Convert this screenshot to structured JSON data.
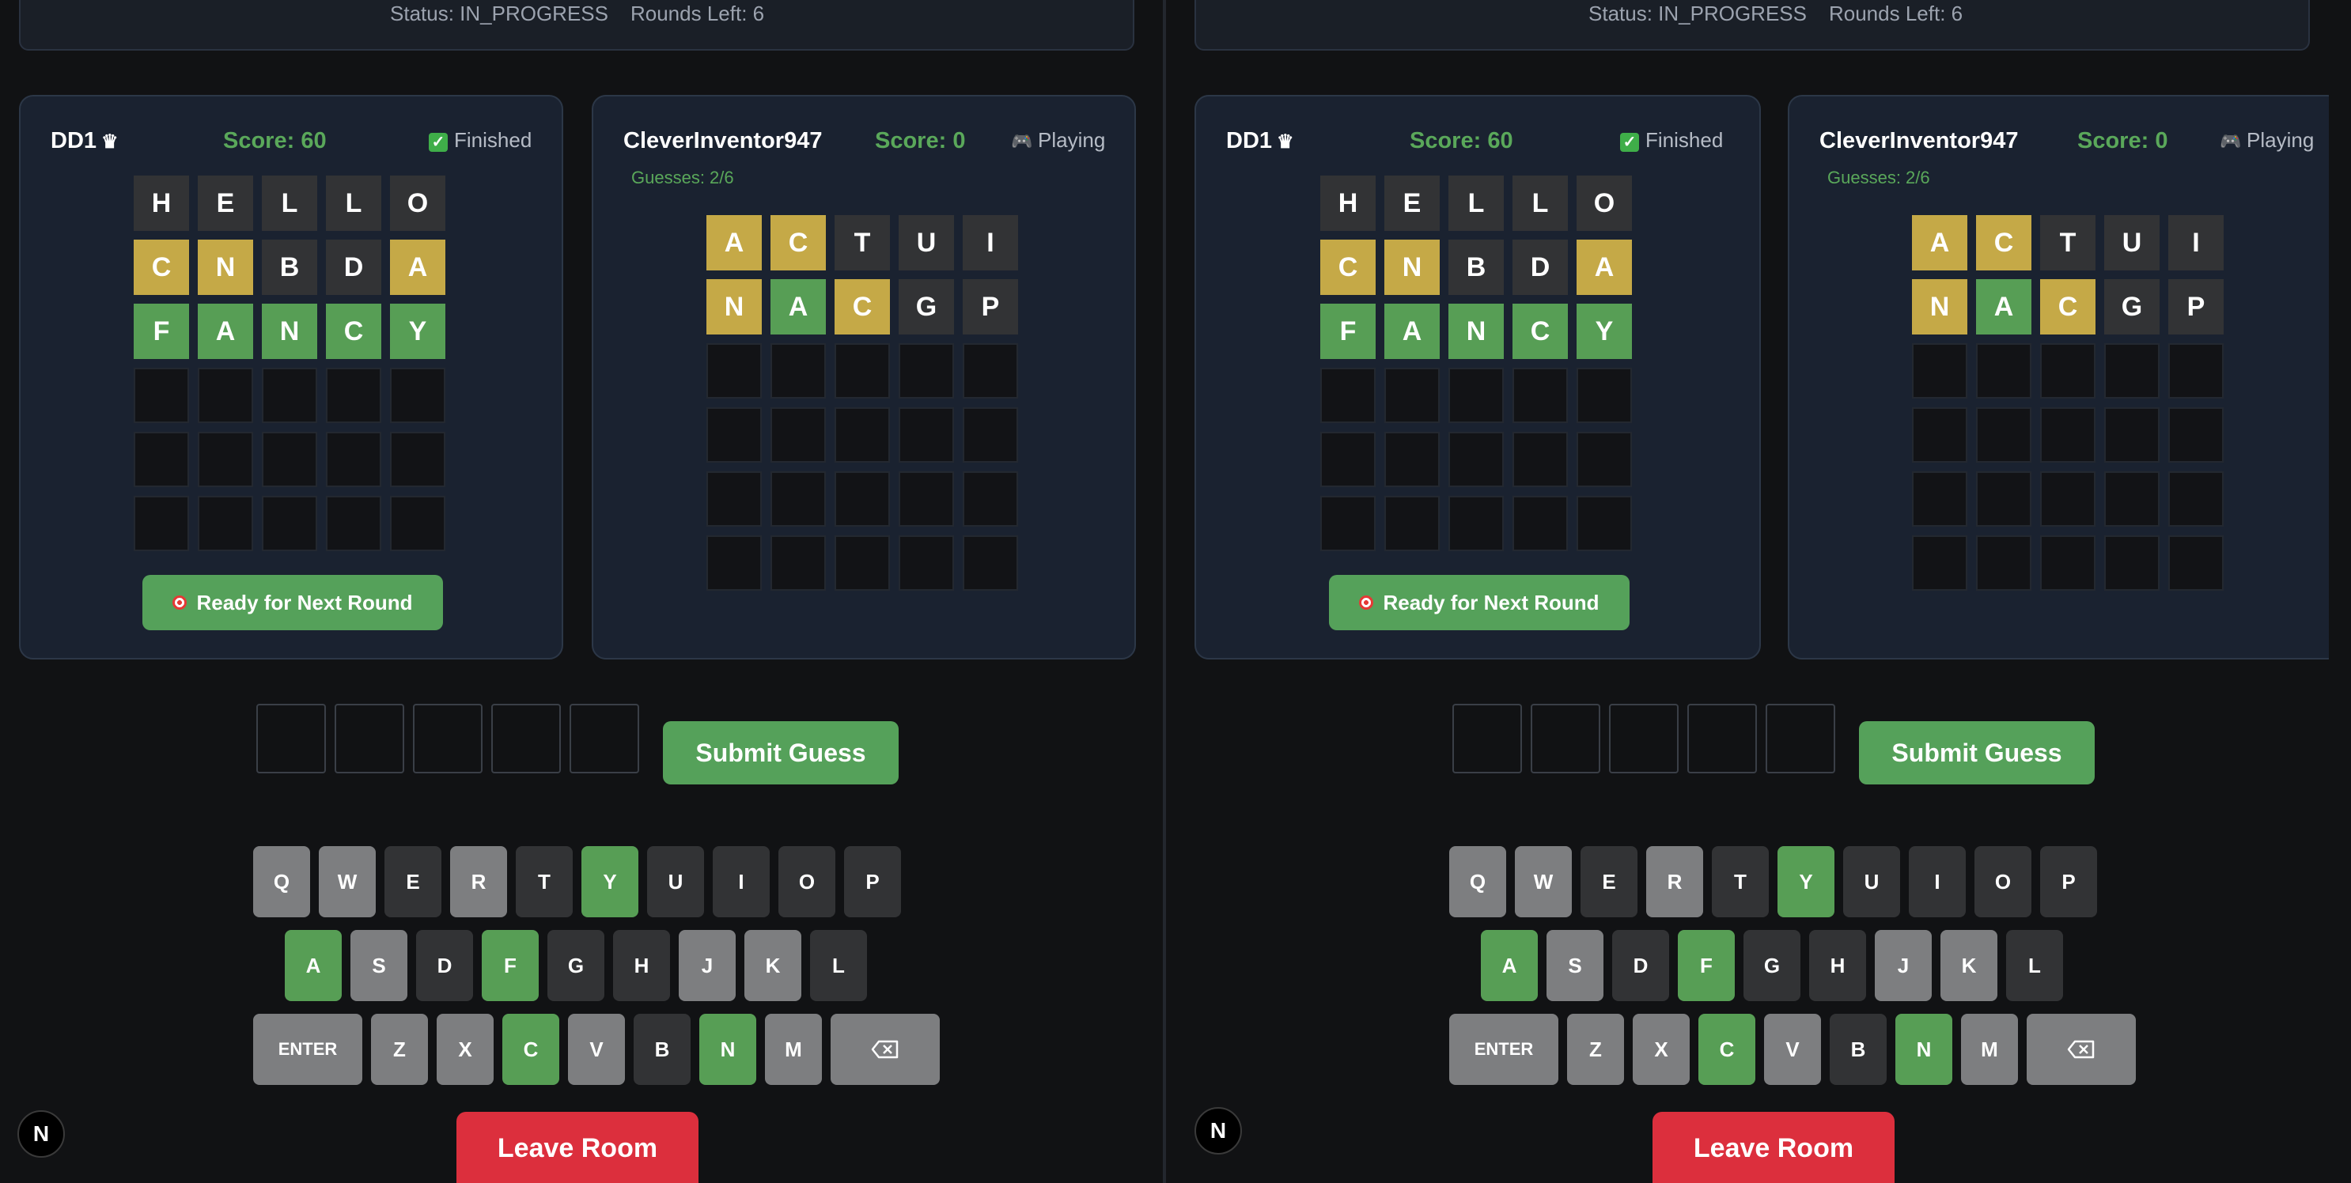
{
  "status": {
    "status_text": "Status: IN_PROGRESS",
    "rounds_text": "Rounds Left: 6"
  },
  "player1": {
    "name": "DD1",
    "crown_icon": "crown-icon",
    "score_text": "Score: 60",
    "state_text": "Finished",
    "state_icon": "check-icon",
    "ready_label": "Ready for Next Round",
    "rows": [
      [
        {
          "l": "H",
          "s": "filled"
        },
        {
          "l": "E",
          "s": "filled"
        },
        {
          "l": "L",
          "s": "filled"
        },
        {
          "l": "L",
          "s": "filled"
        },
        {
          "l": "O",
          "s": "filled"
        }
      ],
      [
        {
          "l": "C",
          "s": "y"
        },
        {
          "l": "N",
          "s": "y"
        },
        {
          "l": "B",
          "s": "filled"
        },
        {
          "l": "D",
          "s": "filled"
        },
        {
          "l": "A",
          "s": "y"
        }
      ],
      [
        {
          "l": "F",
          "s": "g"
        },
        {
          "l": "A",
          "s": "g"
        },
        {
          "l": "N",
          "s": "g"
        },
        {
          "l": "C",
          "s": "g"
        },
        {
          "l": "Y",
          "s": "g"
        }
      ],
      [
        {
          "l": "",
          "s": "empty"
        },
        {
          "l": "",
          "s": "empty"
        },
        {
          "l": "",
          "s": "empty"
        },
        {
          "l": "",
          "s": "empty"
        },
        {
          "l": "",
          "s": "empty"
        }
      ],
      [
        {
          "l": "",
          "s": "empty"
        },
        {
          "l": "",
          "s": "empty"
        },
        {
          "l": "",
          "s": "empty"
        },
        {
          "l": "",
          "s": "empty"
        },
        {
          "l": "",
          "s": "empty"
        }
      ],
      [
        {
          "l": "",
          "s": "empty"
        },
        {
          "l": "",
          "s": "empty"
        },
        {
          "l": "",
          "s": "empty"
        },
        {
          "l": "",
          "s": "empty"
        },
        {
          "l": "",
          "s": "empty"
        }
      ]
    ]
  },
  "player2": {
    "name": "CleverInventor947",
    "score_text": "Score: 0",
    "state_text": "Playing",
    "state_icon": "gamepad-icon",
    "guesses_text": "Guesses: 2/6",
    "rows": [
      [
        {
          "l": "A",
          "s": "y"
        },
        {
          "l": "C",
          "s": "y"
        },
        {
          "l": "T",
          "s": "filled"
        },
        {
          "l": "U",
          "s": "filled"
        },
        {
          "l": "I",
          "s": "filled"
        }
      ],
      [
        {
          "l": "N",
          "s": "y"
        },
        {
          "l": "A",
          "s": "g"
        },
        {
          "l": "C",
          "s": "y"
        },
        {
          "l": "G",
          "s": "filled"
        },
        {
          "l": "P",
          "s": "filled"
        }
      ],
      [
        {
          "l": "",
          "s": "empty"
        },
        {
          "l": "",
          "s": "empty"
        },
        {
          "l": "",
          "s": "empty"
        },
        {
          "l": "",
          "s": "empty"
        },
        {
          "l": "",
          "s": "empty"
        }
      ],
      [
        {
          "l": "",
          "s": "empty"
        },
        {
          "l": "",
          "s": "empty"
        },
        {
          "l": "",
          "s": "empty"
        },
        {
          "l": "",
          "s": "empty"
        },
        {
          "l": "",
          "s": "empty"
        }
      ],
      [
        {
          "l": "",
          "s": "empty"
        },
        {
          "l": "",
          "s": "empty"
        },
        {
          "l": "",
          "s": "empty"
        },
        {
          "l": "",
          "s": "empty"
        },
        {
          "l": "",
          "s": "empty"
        }
      ],
      [
        {
          "l": "",
          "s": "empty"
        },
        {
          "l": "",
          "s": "empty"
        },
        {
          "l": "",
          "s": "empty"
        },
        {
          "l": "",
          "s": "empty"
        },
        {
          "l": "",
          "s": "empty"
        }
      ]
    ]
  },
  "submit_label": "Submit Guess",
  "leave_label": "Leave Room",
  "n_badge": "N",
  "keyboard": [
    [
      {
        "k": "Q",
        "s": "gray"
      },
      {
        "k": "W",
        "s": "gray"
      },
      {
        "k": "E",
        "s": "dark"
      },
      {
        "k": "R",
        "s": "gray"
      },
      {
        "k": "T",
        "s": "dark"
      },
      {
        "k": "Y",
        "s": "green"
      },
      {
        "k": "U",
        "s": "dark"
      },
      {
        "k": "I",
        "s": "dark"
      },
      {
        "k": "O",
        "s": "dark"
      },
      {
        "k": "P",
        "s": "dark"
      }
    ],
    [
      {
        "k": "A",
        "s": "green"
      },
      {
        "k": "S",
        "s": "gray"
      },
      {
        "k": "D",
        "s": "dark"
      },
      {
        "k": "F",
        "s": "green"
      },
      {
        "k": "G",
        "s": "dark"
      },
      {
        "k": "H",
        "s": "dark"
      },
      {
        "k": "J",
        "s": "gray"
      },
      {
        "k": "K",
        "s": "gray"
      },
      {
        "k": "L",
        "s": "dark"
      }
    ],
    [
      {
        "k": "ENTER",
        "s": "gray",
        "wide": true
      },
      {
        "k": "Z",
        "s": "gray"
      },
      {
        "k": "X",
        "s": "gray"
      },
      {
        "k": "C",
        "s": "green"
      },
      {
        "k": "V",
        "s": "gray"
      },
      {
        "k": "B",
        "s": "dark"
      },
      {
        "k": "N",
        "s": "green"
      },
      {
        "k": "M",
        "s": "gray"
      },
      {
        "k": "",
        "s": "gray",
        "wide": true,
        "icon": "backspace-icon"
      }
    ]
  ]
}
